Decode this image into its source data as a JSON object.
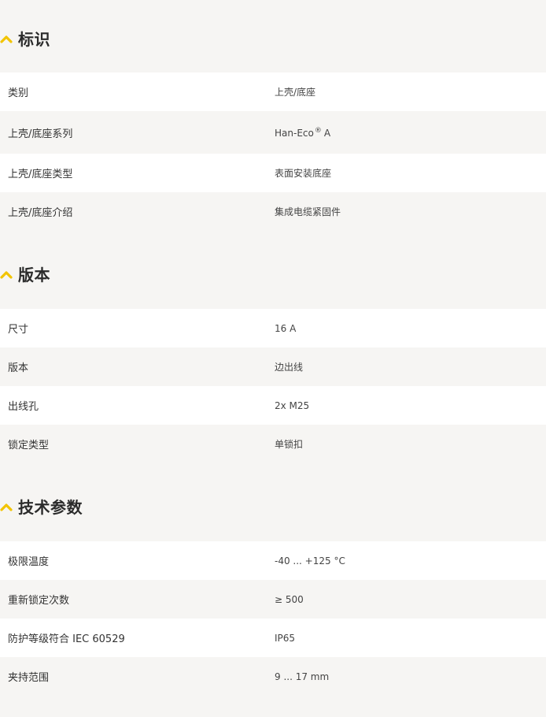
{
  "colors": {
    "accent": "#f2c400",
    "background": "#f6f5f3",
    "row_white": "#ffffff"
  },
  "sections": [
    {
      "title": "标识",
      "icon": "chevron-up-icon",
      "rows": [
        {
          "label": "类别",
          "value": "上壳/底座"
        },
        {
          "label": "上壳/底座系列",
          "value": "Han-Eco",
          "value_mark": "®",
          "value_suffix": "A"
        },
        {
          "label": "上壳/底座类型",
          "value": "表面安装底座"
        },
        {
          "label": "上壳/底座介绍",
          "value": "集成电缆紧固件"
        }
      ]
    },
    {
      "title": "版本",
      "icon": "chevron-up-icon",
      "rows": [
        {
          "label": "尺寸",
          "value": "16 A"
        },
        {
          "label": "版本",
          "value": "边出线"
        },
        {
          "label": "出线孔",
          "value": "2x M25"
        },
        {
          "label": "锁定类型",
          "value": "单锁扣"
        }
      ]
    },
    {
      "title": "技术参数",
      "icon": "chevron-up-icon",
      "rows": [
        {
          "label": "极限温度",
          "value": "-40 ... +125 °C"
        },
        {
          "label": "重新锁定次数",
          "value": "≥ 500"
        },
        {
          "label": "防护等级符合 IEC 60529",
          "value": "IP65"
        },
        {
          "label": "夹持范围",
          "value": "9 ... 17 mm"
        }
      ]
    }
  ]
}
